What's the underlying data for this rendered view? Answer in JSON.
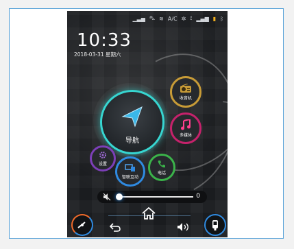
{
  "status": {
    "ac_label": "A/C"
  },
  "clock": {
    "time": "10:33",
    "date": "2018-03-31 星期六"
  },
  "apps": {
    "navigation": "导航",
    "radio": "收音机",
    "media": "多媒体",
    "phone": "电话",
    "settings": "设置",
    "phone_connect": "智联互动"
  },
  "volume": {
    "value": "0",
    "level": 0
  },
  "colors": {
    "nav_ring": "#37d6d1",
    "radio_ring": "#c79b37",
    "media_ring": "#c5226b",
    "phone_ring": "#3bb34a",
    "connect_ring": "#2f8ae0",
    "settings_ring": "#7c3fb8"
  }
}
